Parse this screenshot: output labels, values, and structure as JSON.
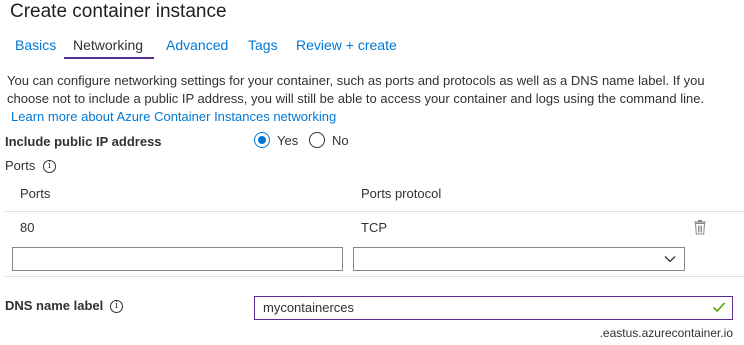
{
  "page": {
    "title": "Create container instance"
  },
  "tabs": [
    {
      "label": "Basics",
      "active": false
    },
    {
      "label": "Networking",
      "active": true
    },
    {
      "label": "Advanced",
      "active": false
    },
    {
      "label": "Tags",
      "active": false
    },
    {
      "label": "Review + create",
      "active": false
    }
  ],
  "description": "You can configure networking settings for your container, such as ports and protocols as well as a DNS name label. If you choose not to include a public IP address, you will still be able to access your container and logs using the command line.",
  "learn_more_link": "Learn more about Azure Container Instances networking",
  "public_ip": {
    "label": "Include public IP address",
    "options": [
      {
        "label": "Yes",
        "selected": true
      },
      {
        "label": "No",
        "selected": false
      }
    ]
  },
  "ports": {
    "label": "Ports",
    "columns": [
      "Ports",
      "Ports protocol"
    ],
    "rows": [
      {
        "port": "80",
        "protocol": "TCP"
      }
    ],
    "new_row": {
      "port": "",
      "protocol": ""
    }
  },
  "dns": {
    "label": "DNS name label",
    "value": "mycontainerces",
    "suffix": ".eastus.azurecontainer.io"
  },
  "icons": {
    "info": "info-icon",
    "delete": "trash-icon",
    "dropdown": "chevron-down-icon",
    "valid": "checkmark-icon"
  },
  "colors": {
    "link": "#0078d4",
    "active_tab_underline": "#5c2d91",
    "radio_selected": "#0078d4",
    "valid_check": "#57a300"
  }
}
